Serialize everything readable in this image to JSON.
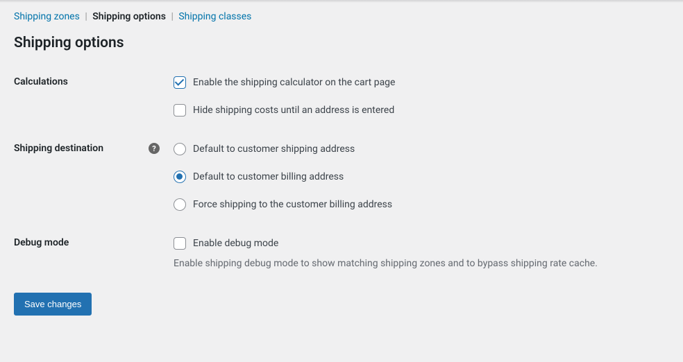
{
  "tabs": {
    "zones": "Shipping zones",
    "options": "Shipping options",
    "classes": "Shipping classes",
    "active": "options"
  },
  "page": {
    "title": "Shipping options"
  },
  "sections": {
    "calculations": {
      "label": "Calculations",
      "enable_calculator": {
        "label": "Enable the shipping calculator on the cart page",
        "checked": true
      },
      "hide_costs": {
        "label": "Hide shipping costs until an address is entered",
        "checked": false
      }
    },
    "destination": {
      "label": "Shipping destination",
      "help": "?",
      "options": {
        "shipping": "Default to customer shipping address",
        "billing": "Default to customer billing address",
        "force_billing": "Force shipping to the customer billing address"
      },
      "selected": "billing"
    },
    "debug": {
      "label": "Debug mode",
      "enable": {
        "label": "Enable debug mode",
        "checked": false
      },
      "description": "Enable shipping debug mode to show matching shipping zones and to bypass shipping rate cache."
    }
  },
  "actions": {
    "save": "Save changes"
  }
}
